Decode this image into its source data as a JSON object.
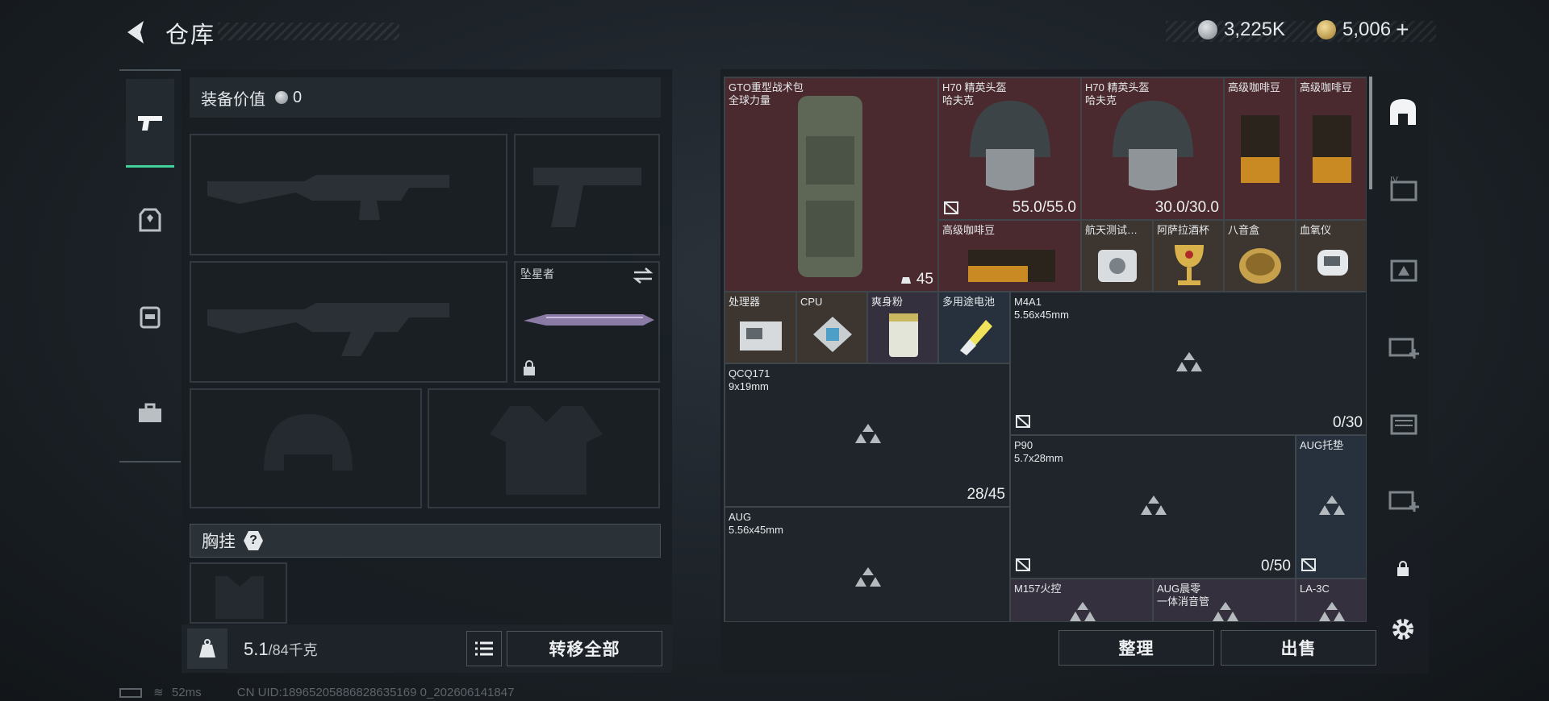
{
  "header": {
    "title": "仓库"
  },
  "currency": {
    "silver": "3,225K",
    "gold": "5,006",
    "plus": "+"
  },
  "equipment": {
    "value_label": "装备价值",
    "value": "0",
    "melee_slot_label": "坠星者",
    "chest_rig_label": "胸挂",
    "chest_rig_help": "?"
  },
  "weight": {
    "current": "5.1",
    "max": "/84千克"
  },
  "buttons": {
    "transfer_all": "转移全部",
    "sort": "整理",
    "sell": "出售"
  },
  "storage_items": [
    {
      "name": "GTO重型战术包",
      "sub": "全球力量",
      "qty": "45",
      "rarity": "red"
    },
    {
      "name": "H70 精英头盔",
      "sub": "哈夫克",
      "qty": "55.0/55.0",
      "rarity": "red"
    },
    {
      "name": "H70 精英头盔",
      "sub": "哈夫克",
      "qty": "30.0/30.0",
      "rarity": "red"
    },
    {
      "name": "高级咖啡豆",
      "sub": "",
      "qty": "",
      "rarity": "red"
    },
    {
      "name": "高级咖啡豆",
      "sub": "",
      "qty": "",
      "rarity": "red"
    },
    {
      "name": "高级咖啡豆",
      "sub": "",
      "qty": "",
      "rarity": "red"
    },
    {
      "name": "航天测试…",
      "sub": "",
      "qty": "",
      "rarity": "gold"
    },
    {
      "name": "阿萨拉酒杯",
      "sub": "",
      "qty": "",
      "rarity": "gold"
    },
    {
      "name": "八音盒",
      "sub": "",
      "qty": "",
      "rarity": "gold"
    },
    {
      "name": "血氧仪",
      "sub": "",
      "qty": "",
      "rarity": "gold"
    },
    {
      "name": "处理器",
      "sub": "",
      "qty": "",
      "rarity": "gold"
    },
    {
      "name": "CPU",
      "sub": "",
      "qty": "",
      "rarity": "gold"
    },
    {
      "name": "爽身粉",
      "sub": "",
      "qty": "",
      "rarity": "purple"
    },
    {
      "name": "多用途电池",
      "sub": "",
      "qty": "",
      "rarity": "blue"
    },
    {
      "name": "M4A1",
      "sub": "5.56x45mm",
      "qty": "0/30",
      "rarity": "gun"
    },
    {
      "name": "QCQ171",
      "sub": "9x19mm",
      "qty": "28/45",
      "rarity": "gun"
    },
    {
      "name": "P90",
      "sub": "5.7x28mm",
      "qty": "0/50",
      "rarity": "gun"
    },
    {
      "name": "AUG托垫",
      "sub": "",
      "qty": "",
      "rarity": "blue"
    },
    {
      "name": "AUG",
      "sub": "5.56x45mm",
      "qty": "",
      "rarity": "gun"
    },
    {
      "name": "M157火控",
      "sub": "",
      "qty": "",
      "rarity": "purple"
    },
    {
      "name": "AUG晨零",
      "sub": "一体消音管",
      "qty": "",
      "rarity": "purple"
    },
    {
      "name": "LA-3C",
      "sub": "",
      "qty": "",
      "rarity": "purple"
    }
  ],
  "status": {
    "ping": "52ms",
    "uid": "CN UID:18965205886828635169 0_202606141847"
  },
  "colors": {
    "accent": "#3fd29a",
    "rarity_red": "#4b2a2f",
    "rarity_gold": "#3c3530",
    "rarity_purple": "#35303d",
    "rarity_blue": "#26313d"
  }
}
